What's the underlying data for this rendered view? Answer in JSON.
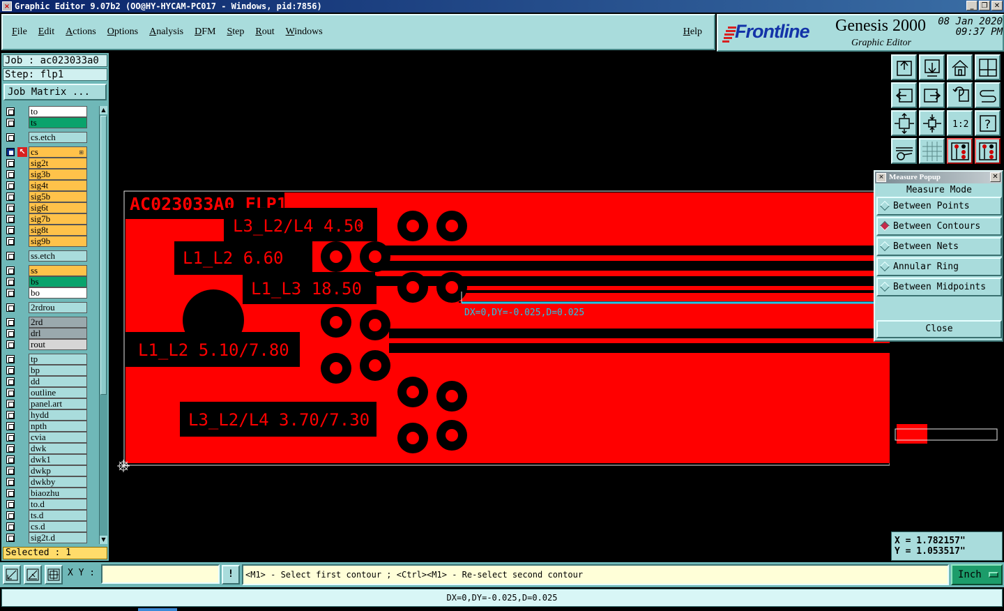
{
  "window": {
    "title": "Graphic Editor 9.07b2 (OO@HY-HYCAM-PC017 - Windows, pid:7856)"
  },
  "menu": {
    "items": [
      "File",
      "Edit",
      "Actions",
      "Options",
      "Analysis",
      "DFM",
      "Step",
      "Rout",
      "Windows"
    ],
    "help": "Help"
  },
  "brand": {
    "logo": "Frontline",
    "product": "Genesis 2000",
    "subtitle": "Graphic Editor",
    "date": "08 Jan 2020",
    "time": "09:37 PM",
    "color": "#1333a8"
  },
  "job": {
    "job_line": "Job : ac023033a0",
    "step_line": "Step: flp1",
    "matrix_button": "Job Matrix ..."
  },
  "layers": [
    {
      "name": "to",
      "color": "white"
    },
    {
      "name": "ts",
      "color": "green"
    },
    {
      "name": "cs.etch",
      "color": "cyan"
    },
    {
      "name": "cs",
      "color": "orange",
      "active": true
    },
    {
      "name": "sig2t",
      "color": "orange"
    },
    {
      "name": "sig3b",
      "color": "orange"
    },
    {
      "name": "sig4t",
      "color": "orange"
    },
    {
      "name": "sig5b",
      "color": "orange"
    },
    {
      "name": "sig6t",
      "color": "orange"
    },
    {
      "name": "sig7b",
      "color": "orange"
    },
    {
      "name": "sig8t",
      "color": "orange"
    },
    {
      "name": "sig9b",
      "color": "orange"
    },
    {
      "name": "ss.etch",
      "color": "cyan"
    },
    {
      "name": "ss",
      "color": "orange"
    },
    {
      "name": "bs",
      "color": "green"
    },
    {
      "name": "bo",
      "color": "white"
    },
    {
      "name": "2rdrou",
      "color": "cyan"
    },
    {
      "name": "2rd",
      "color": "gray"
    },
    {
      "name": "drl",
      "color": "gray"
    },
    {
      "name": "rout",
      "color": "lgray"
    },
    {
      "name": "tp",
      "color": "cyan"
    },
    {
      "name": "bp",
      "color": "cyan"
    },
    {
      "name": "dd",
      "color": "cyan"
    },
    {
      "name": "outline",
      "color": "cyan"
    },
    {
      "name": "panel.art",
      "color": "cyan"
    },
    {
      "name": "hydd",
      "color": "cyan"
    },
    {
      "name": "npth",
      "color": "cyan"
    },
    {
      "name": "cvia",
      "color": "cyan"
    },
    {
      "name": "dwk",
      "color": "cyan"
    },
    {
      "name": "dwk1",
      "color": "cyan"
    },
    {
      "name": "dwkp",
      "color": "cyan"
    },
    {
      "name": "dwkby",
      "color": "cyan"
    },
    {
      "name": "biaozhu",
      "color": "cyan"
    },
    {
      "name": "to.d",
      "color": "cyan"
    },
    {
      "name": "ts.d",
      "color": "cyan"
    },
    {
      "name": "cs.d",
      "color": "cyan"
    },
    {
      "name": "sig2t.d",
      "color": "cyan"
    }
  ],
  "selection": {
    "text": "Selected : 1"
  },
  "canvas": {
    "board_title": "AC023033A0 FLP1",
    "labels": [
      "L3_L2/L4 4.50",
      "L1_L2 6.60",
      "L1_L3 18.50",
      "L1_L2 5.10/7.80",
      "L3_L2/L4 3.70/7.30"
    ],
    "measure_text": "DX=0,DY=-0.025,D=0.025",
    "copper_color": "#ff0000",
    "measure_color": "#20c8e8"
  },
  "measure_popup": {
    "title": "Measure Popup",
    "header": "Measure Mode",
    "options": [
      "Between Points",
      "Between Contours",
      "Between Nets",
      "Annular Ring",
      "Between Midpoints"
    ],
    "selected_option": "Between Contours",
    "close_label": "Close"
  },
  "coords": {
    "x": "X = 1.782157\"",
    "y": "Y = 1.053517\""
  },
  "bottom": {
    "xy_label": "X Y :",
    "xy_value": "",
    "info_label": "!",
    "hint": "<M1> - Select first contour ; <Ctrl><M1> - Re-select second contour",
    "unit": "Inch"
  },
  "status": {
    "text": "DX=0,DY=-0.025,D=0.025"
  },
  "toolbar": {
    "icons": [
      "open-top-icon",
      "open-bottom-icon",
      "home-icon",
      "window-icon",
      "pan-left-icon",
      "pan-right-icon",
      "undo-zoom-icon",
      "redraw-icon",
      "zoom-fit-icon",
      "zoom-center-icon",
      "scale-one-to-one-icon",
      "help-query-icon",
      "settings-icon",
      "grid-icon",
      "snap-left-icon",
      "snap-right-icon"
    ],
    "scale_label": "1:2"
  }
}
